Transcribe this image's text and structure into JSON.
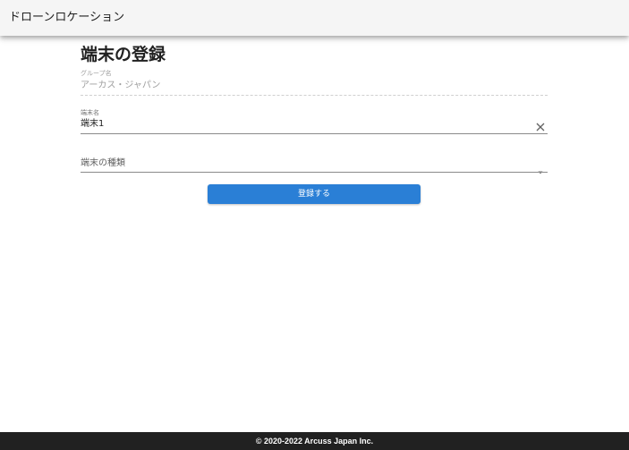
{
  "app_bar": {
    "title": "ドローンロケーション"
  },
  "page": {
    "title": "端末の登録"
  },
  "form": {
    "group_name": {
      "label": "グループ名",
      "value": "アーカス・ジャパン",
      "disabled": true
    },
    "device_name": {
      "label": "端末名",
      "value": "端末1",
      "clear_icon": "close-icon"
    },
    "device_type": {
      "label": "端末の種類",
      "value": "",
      "dropdown_icon": "dropdown-arrow-icon"
    },
    "submit_label": "登録する"
  },
  "footer": {
    "copyright": "© 2020-2022 Arcuss Japan Inc."
  },
  "colors": {
    "app_bar_bg": "#f5f5f5",
    "primary": "#2a7fd6",
    "footer_bg": "#212121"
  }
}
